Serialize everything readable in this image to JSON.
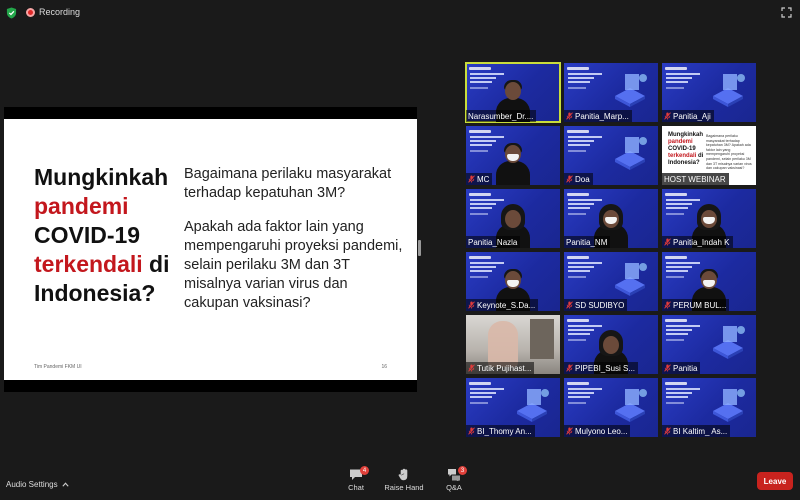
{
  "top_bar": {
    "recording_label": "Recording",
    "recording_color": "#e02828",
    "security_icon": "shield-check-icon",
    "fullscreen_icon": "expand-icon"
  },
  "shared_slide": {
    "title_lines": [
      "Mungkinkah",
      "pandemi",
      "COVID-19",
      "terkendali",
      "di",
      "Indonesia?"
    ],
    "title_highlight_color": "#c3171d",
    "body_paragraphs": [
      "Bagaimana perilaku masyarakat terhadap kepatuhan 3M?",
      "Apakah ada faktor lain yang mempengaruhi proyeksi pandemi, selain perilaku 3M dan 3T misalnya varian virus dan cakupan vaksinasi?"
    ],
    "footer_text": "Tim Pandemi FKM UI",
    "page_number": "16"
  },
  "gallery": {
    "tiles": [
      {
        "name": "Narasumber_Dr....",
        "muted": false,
        "video": "person",
        "active": true
      },
      {
        "name": "Panitia_Marp...",
        "muted": true,
        "video": "slide"
      },
      {
        "name": "Panitia_Aji",
        "muted": true,
        "video": "slide"
      },
      {
        "name": "MC",
        "muted": true,
        "video": "person"
      },
      {
        "name": "Doa",
        "muted": true,
        "video": "slide"
      },
      {
        "name": "HOST WEBINAR",
        "muted": false,
        "video": "white"
      },
      {
        "name": "Panitia_Nazla",
        "muted": false,
        "video": "person"
      },
      {
        "name": "Panitia_NM",
        "muted": false,
        "video": "person"
      },
      {
        "name": "Panitia_Indah K",
        "muted": true,
        "video": "person"
      },
      {
        "name": "Keynote_S.Da...",
        "muted": true,
        "video": "person"
      },
      {
        "name": "SD SUDIBYO",
        "muted": true,
        "video": "slide"
      },
      {
        "name": "PERUM BUL...",
        "muted": true,
        "video": "person"
      },
      {
        "name": "Tutik Pujihast...",
        "muted": true,
        "video": "room"
      },
      {
        "name": "PIPEBI_Susi S...",
        "muted": true,
        "video": "person"
      },
      {
        "name": "Panitia",
        "muted": true,
        "video": "slide"
      },
      {
        "name": "BI_Thomy An...",
        "muted": true,
        "video": "slide"
      },
      {
        "name": "Mulyono Leo...",
        "muted": true,
        "video": "slide"
      },
      {
        "name": "BI Kaltim_ As...",
        "muted": true,
        "video": "slide"
      }
    ],
    "host_slide_title": [
      "Mungkinkah",
      "pandemi",
      "COVID-19",
      "terkendali",
      "di",
      "Indonesia?"
    ],
    "host_slide_body": "Bagaimana perilaku masyarakat terhadap kepatuhan 3M? Apakah ada faktor lain yang mempengaruhi proyeksi pandemi, selain perilaku 3M dan 3T misalnya varian virus dan cakupan vaksinasi?"
  },
  "toolbar": {
    "audio_settings_label": "Audio Settings",
    "chat_label": "Chat",
    "chat_badge": "4",
    "raise_hand_label": "Raise Hand",
    "qa_label": "Q&A",
    "qa_badge": "3",
    "leave_label": "Leave",
    "leave_color": "#c8231e"
  }
}
